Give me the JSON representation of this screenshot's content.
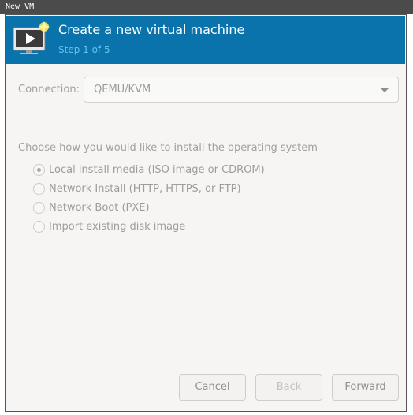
{
  "window": {
    "title": "New VM"
  },
  "header": {
    "title": "Create a new virtual machine",
    "subtitle": "Step 1 of 5",
    "icon": "vm-monitor-icon"
  },
  "connection": {
    "label": "Connection:",
    "value": "QEMU/KVM"
  },
  "install": {
    "prompt": "Choose how you would like to install the operating system",
    "options": [
      {
        "label": "Local install media (ISO image or CDROM)",
        "checked": true
      },
      {
        "label": "Network Install (HTTP, HTTPS, or FTP)",
        "checked": false
      },
      {
        "label": "Network Boot (PXE)",
        "checked": false
      },
      {
        "label": "Import existing disk image",
        "checked": false
      }
    ]
  },
  "buttons": {
    "cancel": "Cancel",
    "back": "Back",
    "forward": "Forward"
  },
  "colors": {
    "header_bg": "#0a73ab",
    "subtitle": "#63c3f2",
    "titlebar": "#4b4b4b"
  }
}
